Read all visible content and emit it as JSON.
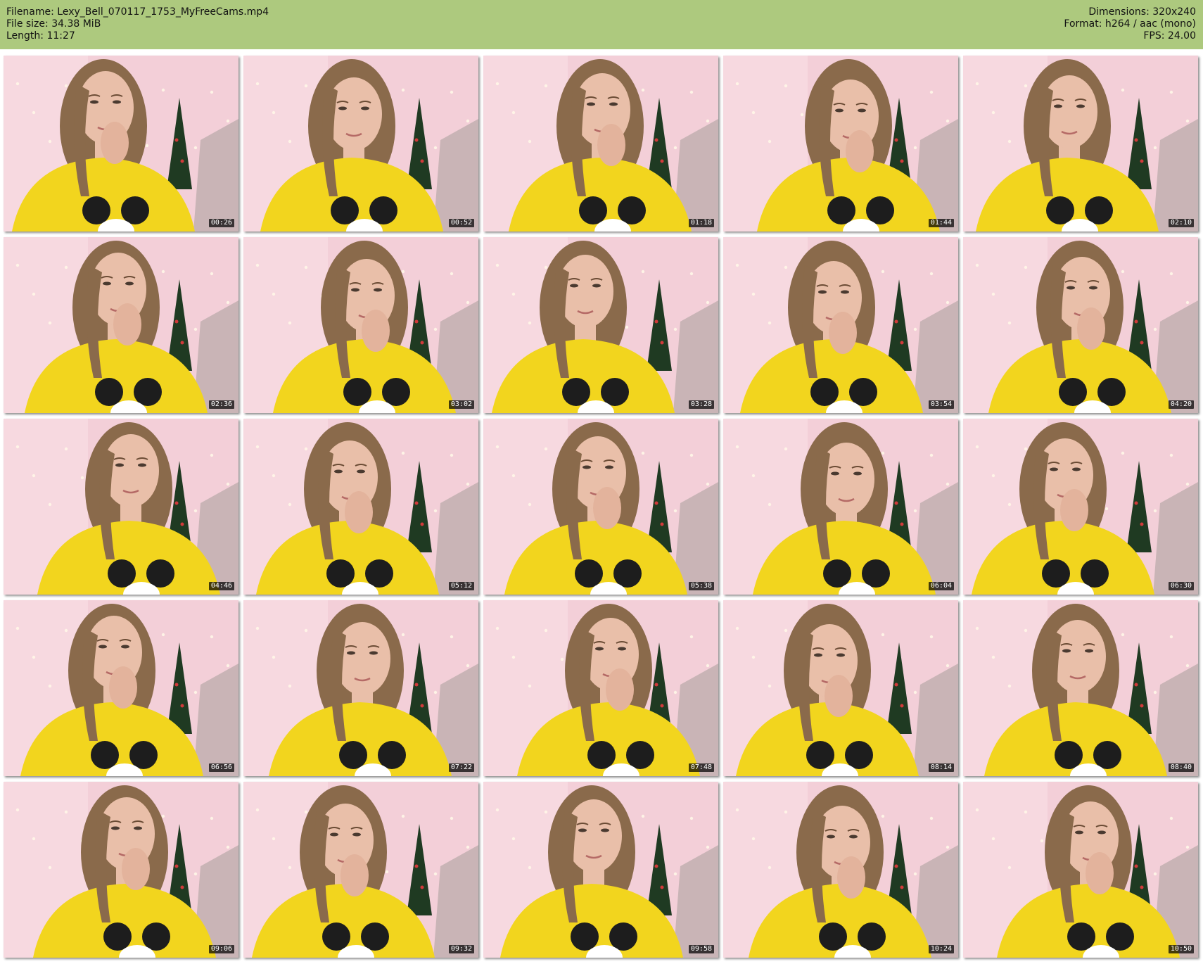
{
  "header": {
    "filename_line": "Filename: Lexy_Bell_070117_1753_MyFreeCams.mp4",
    "filesize_line": "File size: 34.38 MiB",
    "length_line": "Length: 11:27",
    "dimensions_line": "Dimensions: 320x240",
    "format_line": "Format: h264 / aac (mono)",
    "fps_line": "FPS: 24.00"
  },
  "colors": {
    "header_bg": "#adc97e",
    "frame_background": "#f3cfd8",
    "shirt": "#f2d51e",
    "hair": "#8a6a4b",
    "skin": "#e9bfa9",
    "ears_print": "#1d1d1d"
  },
  "thumbnails": [
    {
      "timestamp": "00:26"
    },
    {
      "timestamp": "00:52"
    },
    {
      "timestamp": "01:18"
    },
    {
      "timestamp": "01:44"
    },
    {
      "timestamp": "02:10"
    },
    {
      "timestamp": "02:36"
    },
    {
      "timestamp": "03:02"
    },
    {
      "timestamp": "03:28"
    },
    {
      "timestamp": "03:54"
    },
    {
      "timestamp": "04:20"
    },
    {
      "timestamp": "04:46"
    },
    {
      "timestamp": "05:12"
    },
    {
      "timestamp": "05:38"
    },
    {
      "timestamp": "06:04"
    },
    {
      "timestamp": "06:30"
    },
    {
      "timestamp": "06:56"
    },
    {
      "timestamp": "07:22"
    },
    {
      "timestamp": "07:48"
    },
    {
      "timestamp": "08:14"
    },
    {
      "timestamp": "08:40"
    },
    {
      "timestamp": "09:06"
    },
    {
      "timestamp": "09:32"
    },
    {
      "timestamp": "09:58"
    },
    {
      "timestamp": "10:24"
    },
    {
      "timestamp": "10:50"
    }
  ]
}
